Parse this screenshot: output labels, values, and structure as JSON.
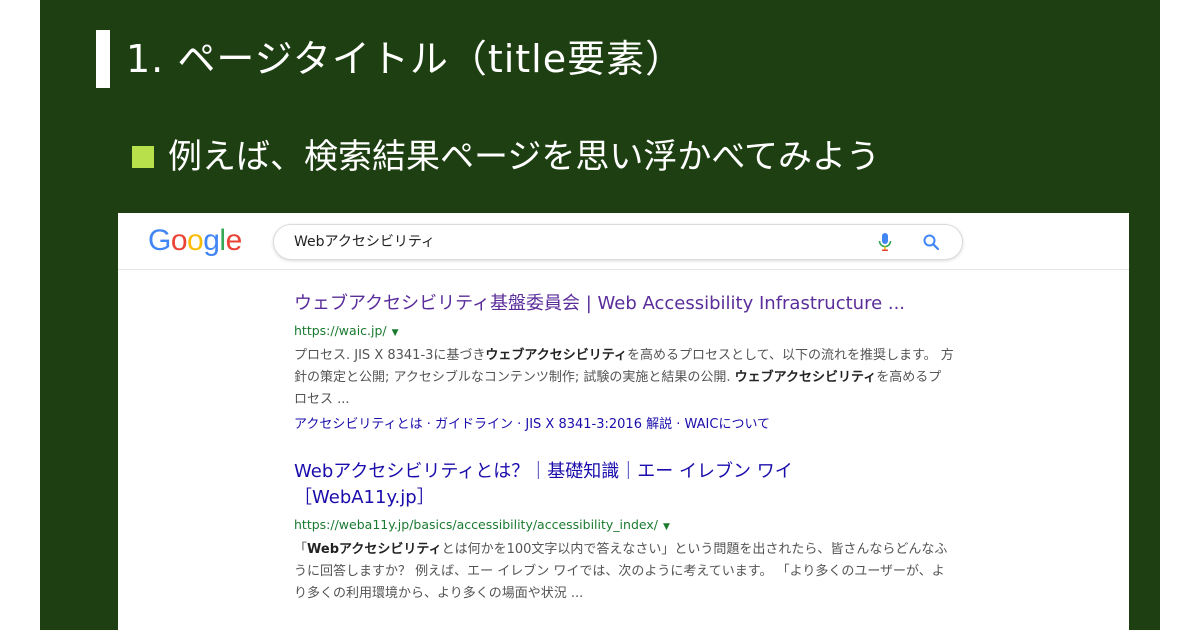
{
  "slide": {
    "title": "1. ページタイトル（title要素）",
    "bullet": "例えば、検索結果ページを思い浮かべてみよう"
  },
  "google": {
    "logo_letters": [
      {
        "char": "G",
        "color": "#4285F4"
      },
      {
        "char": "o",
        "color": "#EA4335"
      },
      {
        "char": "o",
        "color": "#FBBC05"
      },
      {
        "char": "g",
        "color": "#4285F4"
      },
      {
        "char": "l",
        "color": "#34A853"
      },
      {
        "char": "e",
        "color": "#EA4335"
      }
    ],
    "search_value": "Webアクセシビリティ",
    "icons": {
      "mic": "mic-icon",
      "search": "search-icon"
    }
  },
  "results": [
    {
      "title": "ウェブアクセシビリティ基盤委員会 | Web Accessibility Infrastructure ...",
      "url": "https://waic.jp/",
      "snippet_parts": [
        {
          "text": "プロセス. JIS X 8341-3に基づき",
          "bold": false
        },
        {
          "text": "ウェブアクセシビリティ",
          "bold": true
        },
        {
          "text": "を高めるプロセスとして、以下の流れを推奨します。 方針の策定と公開; アクセシブルなコンテンツ制作; 試験の実施と結果の公開. ",
          "bold": false
        },
        {
          "text": "ウェブアクセシビリティ",
          "bold": true
        },
        {
          "text": "を高めるプロセス ...",
          "bold": false
        }
      ],
      "sitelinks": "アクセシビリティとは · ガイドライン · JIS X 8341-3:2016 解説 · WAICについて"
    },
    {
      "title": "Webアクセシビリティとは？｜基礎知識｜エー イレブン ワイ［WebA11y.jp］",
      "url": "https://weba11y.jp/basics/accessibility/accessibility_index/",
      "snippet_parts": [
        {
          "text": "「",
          "bold": false
        },
        {
          "text": "Webアクセシビリティ",
          "bold": true
        },
        {
          "text": "とは何かを100文字以内で答えなさい」という問題を出されたら、皆さんならどんなふうに回答しますか？ 例えば、エー イレブン ワイでは、次のように考えています。 「より多くのユーザーが、より多くの利用環境から、より多くの場面や状況 ...",
          "bold": false
        }
      ]
    }
  ],
  "colors": {
    "slide_bg": "#1e3f12",
    "bullet_square": "#b8e04a",
    "visited_link": "#5a2d9a",
    "link": "#1a0dab",
    "url_green": "#1a7a30"
  }
}
